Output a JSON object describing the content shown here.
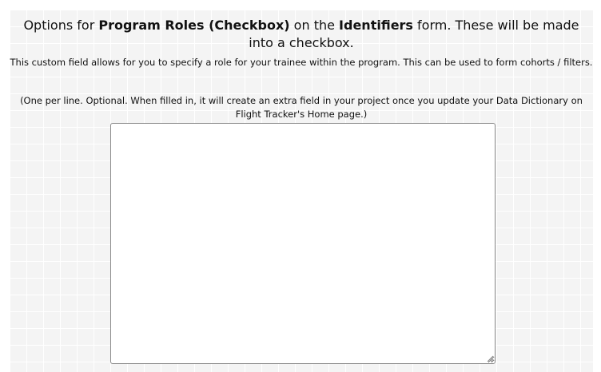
{
  "heading": {
    "prefix": "Options for ",
    "field_name": "Program Roles (Checkbox)",
    "middle": " on the ",
    "form_name": "Identifiers",
    "suffix": " form. These will be made into a checkbox."
  },
  "description": "This custom field allows for you to specify a role for your trainee within the program. This can be used to form cohorts / filters.",
  "note": "(One per line. Optional. When filled in, it will create an extra field in your project once you update your Data Dictionary on Flight Tracker's Home page.)",
  "options_textarea": {
    "value": "",
    "placeholder": ""
  },
  "icons": {
    "resize_grip": "resize-grip-icon"
  }
}
